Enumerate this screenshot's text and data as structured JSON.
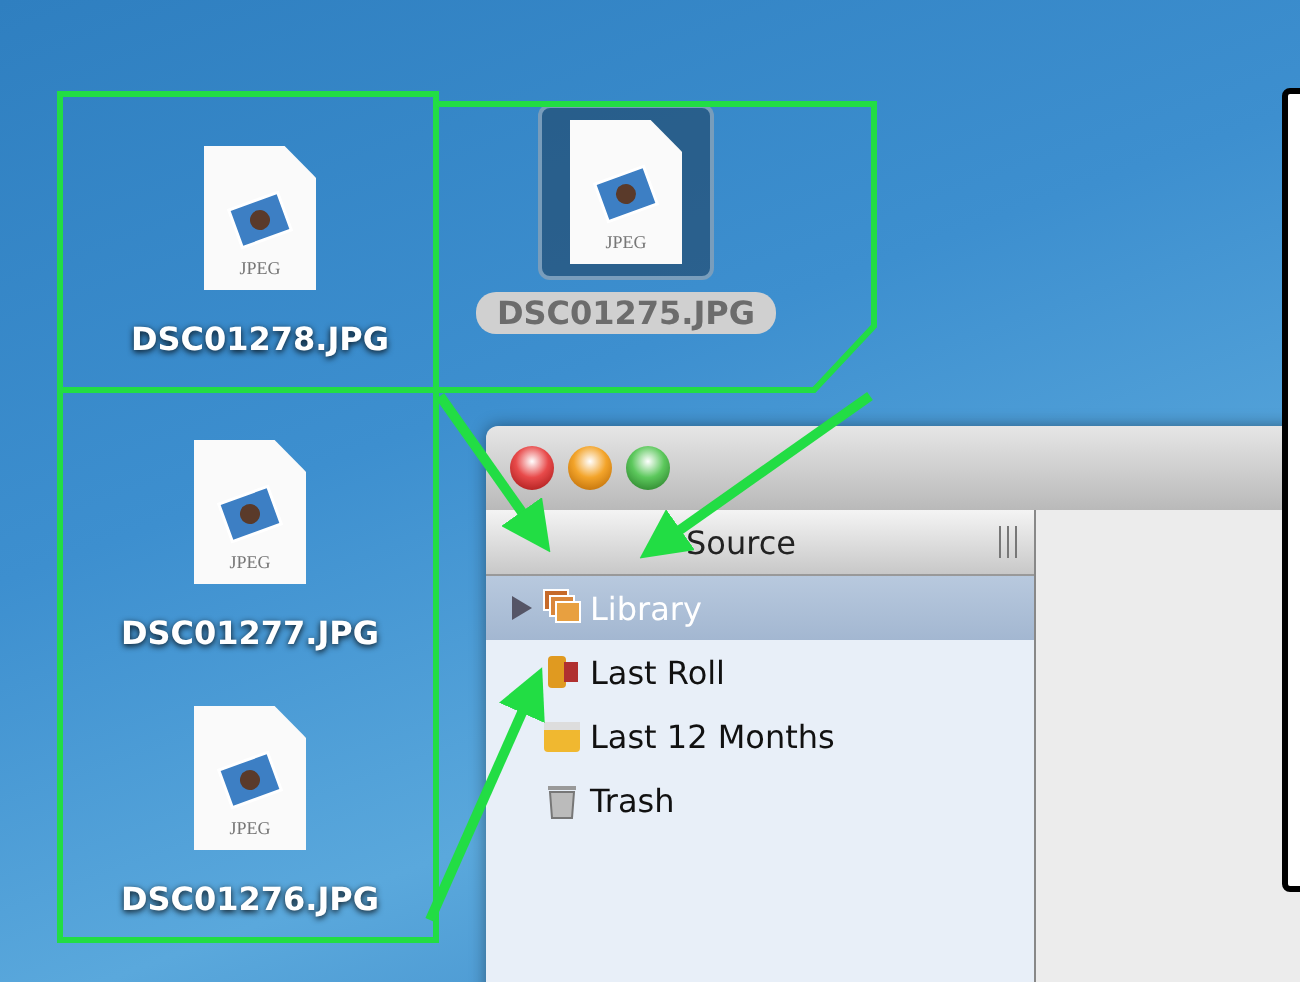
{
  "desktop_files": [
    {
      "name": "DSC01278.JPG",
      "type_label": "JPEG",
      "selected": false
    },
    {
      "name": "DSC01275.JPG",
      "type_label": "JPEG",
      "selected": true
    },
    {
      "name": "DSC01277.JPG",
      "type_label": "JPEG",
      "selected": false
    },
    {
      "name": "DSC01276.JPG",
      "type_label": "JPEG",
      "selected": false
    }
  ],
  "window": {
    "source_header": "Source",
    "sources": [
      {
        "label": "Library",
        "kind": "library",
        "selected": true,
        "expandable": true
      },
      {
        "label": "Last Roll",
        "kind": "roll",
        "selected": false,
        "expandable": false
      },
      {
        "label": "Last 12 Months",
        "kind": "calendar",
        "selected": false,
        "expandable": false
      },
      {
        "label": "Trash",
        "kind": "trash",
        "selected": false,
        "expandable": false
      }
    ]
  }
}
